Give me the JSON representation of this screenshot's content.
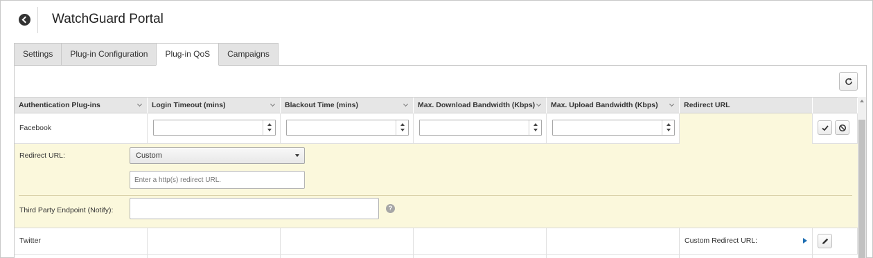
{
  "header": {
    "title": "WatchGuard Portal"
  },
  "tabs": [
    {
      "label": "Settings"
    },
    {
      "label": "Plug-in Configuration"
    },
    {
      "label": "Plug-in QoS",
      "active": true
    },
    {
      "label": "Campaigns"
    }
  ],
  "table": {
    "columns": [
      "Authentication Plug-ins",
      "Login Timeout (mins)",
      "Blackout Time (mins)",
      "Max. Download Bandwidth (Kbps)",
      "Max. Upload Bandwidth (Kbps)",
      "Redirect URL"
    ],
    "rows": [
      {
        "plugin": "Facebook",
        "login_timeout": "",
        "blackout_time": "",
        "max_download": "",
        "max_upload": "",
        "redirect_url": ""
      },
      {
        "plugin": "Twitter",
        "redirect_url": "Custom Redirect URL:"
      }
    ]
  },
  "edit_panel": {
    "redirect_label": "Redirect URL:",
    "redirect_selected": "Custom",
    "redirect_placeholder": "Enter a http(s) redirect URL.",
    "endpoint_label": "Third Party Endpoint (Notify):",
    "endpoint_value": "",
    "help_glyph": "?"
  },
  "icons": {
    "back": "back-arrow-icon",
    "refresh": "refresh-icon",
    "save": "checkmark-icon",
    "cancel": "cancel-icon",
    "expand": "play-arrow-icon",
    "edit": "pencil-icon",
    "help": "help-icon"
  },
  "colors": {
    "edit_row_background": "#fbf8dc",
    "header_background": "#e6e6e6",
    "link_arrow": "#1f6fb2"
  }
}
